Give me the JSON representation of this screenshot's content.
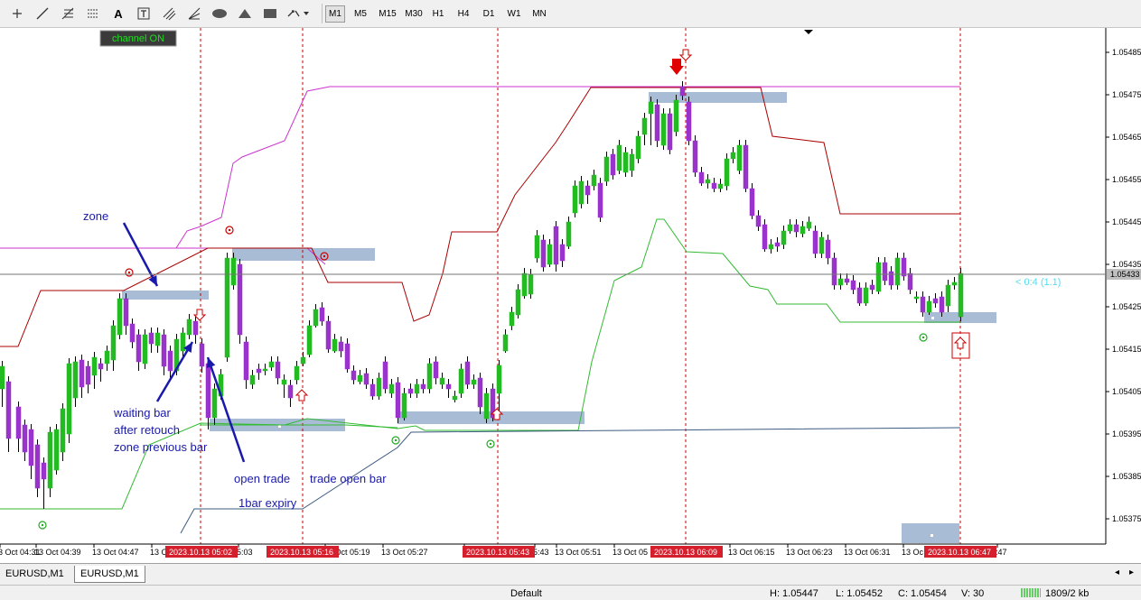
{
  "toolbar": {
    "tools": [
      "cursor-icon",
      "line-icon",
      "fibonacci-icon",
      "fibonacci-fan-icon",
      "text-icon",
      "text-label-icon",
      "channel-icon",
      "gann-icon",
      "ellipse-icon",
      "triangle-icon",
      "rectangle-icon",
      "arrows-icon"
    ],
    "timeframes": [
      "M1",
      "M5",
      "M15",
      "M30",
      "H1",
      "H4",
      "D1",
      "W1",
      "MN"
    ],
    "active_timeframe": "M1"
  },
  "chart": {
    "symbol": "EURUSD,M1",
    "channel_button": "channel ON",
    "current_price": "1.05433",
    "info_label": "< 0:4 (1.1)",
    "price_labels": [
      "1.05485",
      "1.05475",
      "1.05465",
      "1.05455",
      "1.05445",
      "1.05435",
      "1.05425",
      "1.05415",
      "1.05405",
      "1.05395",
      "1.05385",
      "1.05375"
    ],
    "time_labels": [
      "3 Oct 04:31",
      "13 Oct 04:39",
      "13 Oct 04:47",
      "13 Oc",
      "5:03",
      "13 Oct 05:19",
      "13 Oct 05:27",
      "13 Oct",
      "5:43",
      "13 Oct 05:51",
      "13 Oct 05",
      "13 Oct 06:15",
      "13 Oct 06:23",
      "13 Oct 06:31",
      "13 Oc",
      ":47"
    ],
    "highlight_times": [
      "2023.10.13 05:02",
      "2023.10.13 05:16",
      "2023.10.13 05:43",
      "2023.10.13 06:09",
      "2023.10.13 06:47"
    ],
    "annotations": {
      "zone": "zone",
      "waiting_1": "waiting bar",
      "waiting_2": "after retouch",
      "waiting_3": "zone previous bar",
      "open_trade": "open trade",
      "trade_open_bar": "trade open bar",
      "expiry": "1bar expiry"
    },
    "colors": {
      "bull": "#22bb22",
      "bear": "#9933cc",
      "upper_channel": "#cc33cc",
      "resistance": "#aa0000",
      "support": "#33bb33",
      "zone": "#a8bcd6",
      "marker": "#cc0000",
      "annotation": "#1a1aaa"
    }
  },
  "tabs": [
    "EURUSD,M1",
    "EURUSD,M1"
  ],
  "active_tab": 1,
  "status": {
    "profile": "Default",
    "high": "H: 1.05447",
    "low": "L: 1.05452",
    "close": "C: 1.05454",
    "volume": "V: 30",
    "traffic": "1809/2 kb"
  }
}
